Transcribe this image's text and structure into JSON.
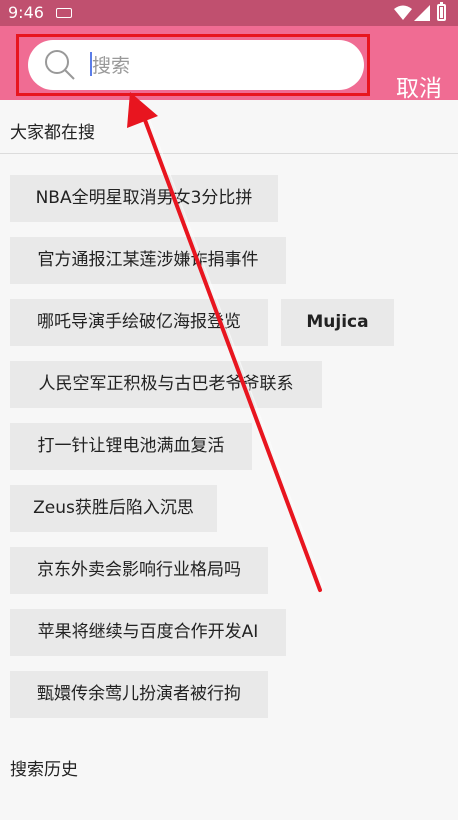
{
  "status_bar": {
    "time": "9:46"
  },
  "search": {
    "placeholder": "搜索",
    "value": "",
    "cancel_label": "取消"
  },
  "trending": {
    "title": "大家都在搜",
    "items": [
      "NBA全明星取消男女3分比拼",
      "官方通报江某莲涉嫌诈捐事件",
      "哪吒导演手绘破亿海报登览",
      "Mujica",
      "人民空军正积极与古巴老爷爷联系",
      "打一针让锂电池满血复活",
      "Zeus获胜后陷入沉思",
      "京东外卖会影响行业格局吗",
      "苹果将继续与百度合作开发AI",
      "甄嬛传余莺儿扮演者被行拘"
    ]
  },
  "history": {
    "title": "搜索历史"
  },
  "colors": {
    "status_bar": "#c0506f",
    "top_bar": "#f06c93",
    "highlight": "#e8151f",
    "chip_bg": "#e9e9e9",
    "page_bg": "#f7f7f7"
  }
}
